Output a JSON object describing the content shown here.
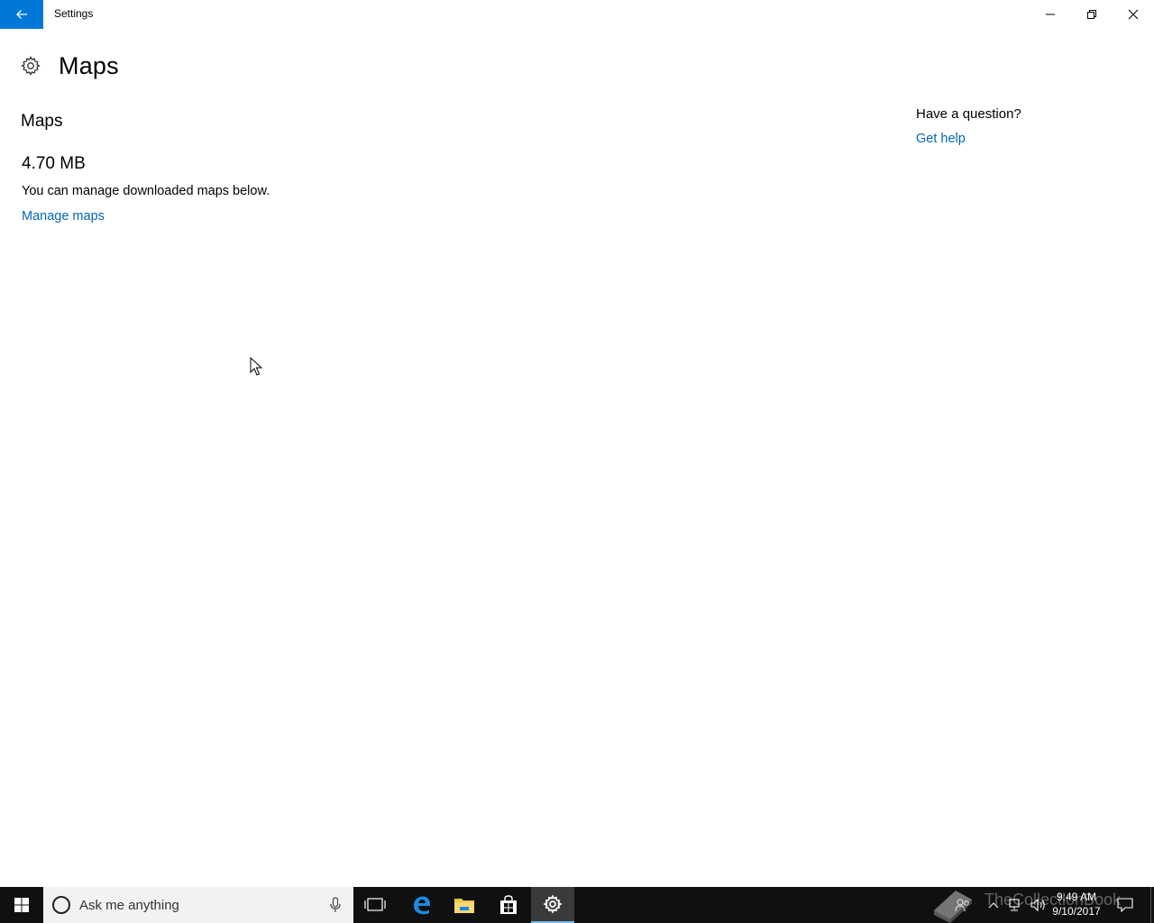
{
  "window": {
    "title": "Settings"
  },
  "page": {
    "title": "Maps",
    "section_title": "Maps",
    "size_value": "4.70 MB",
    "description": "You can manage downloaded maps below.",
    "manage_link": "Manage maps"
  },
  "help": {
    "question": "Have a question?",
    "link": "Get help"
  },
  "taskbar": {
    "search_placeholder": "Ask me anything",
    "time": "9:49 AM",
    "date": "9/10/2017",
    "active_app": "settings"
  },
  "watermark": {
    "text": "TheCollectionBook"
  },
  "colors": {
    "accent": "#0078d7",
    "link": "#0067b8",
    "taskbar": "#101010"
  }
}
